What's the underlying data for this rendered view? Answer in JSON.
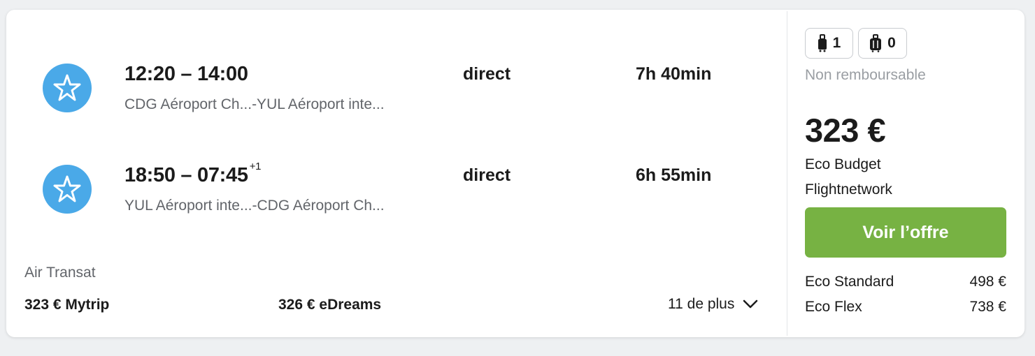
{
  "legs": [
    {
      "times": "12:20 – 14:00",
      "day_offset": "",
      "route": "CDG Aéroport Ch...-YUL Aéroport inte...",
      "stops": "direct",
      "duration": "7h 40min",
      "airline_icon": "air-transat-star-icon"
    },
    {
      "times": "18:50 – 07:45",
      "day_offset": "+1",
      "route": "YUL Aéroport inte...-CDG Aéroport Ch...",
      "stops": "direct",
      "duration": "6h 55min",
      "airline_icon": "air-transat-star-icon"
    }
  ],
  "airline": "Air Transat",
  "alternatives": [
    {
      "label": "323 € Mytrip"
    },
    {
      "label": "326 € eDreams"
    }
  ],
  "more_label": "11 de plus",
  "baggage": {
    "cabin_count": "1",
    "checked_count": "0"
  },
  "refund_text": "Non remboursable",
  "price": "323 €",
  "fare_name": "Eco Budget",
  "provider": "Flightnetwork",
  "offer_button": "Voir l’offre",
  "other_fares": [
    {
      "name": "Eco Standard",
      "price": "498 €"
    },
    {
      "name": "Eco Flex",
      "price": "738 €"
    }
  ],
  "colors": {
    "button": "#77b243",
    "logo": "#4aa9e8"
  }
}
